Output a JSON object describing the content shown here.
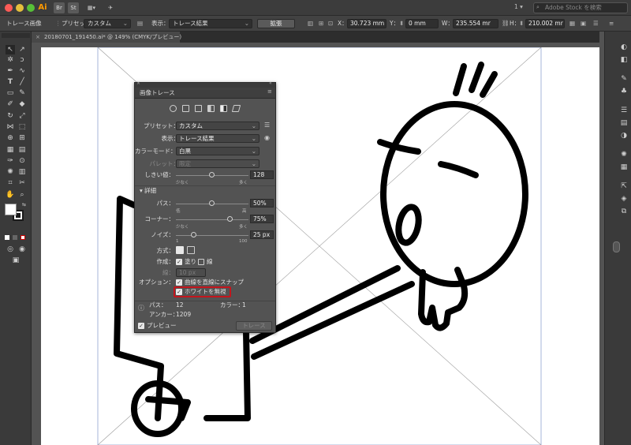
{
  "titlebar": {
    "app_logo": "Ai",
    "bridge_label": "Br",
    "stock_label": "St",
    "workspace_number": "1",
    "stock_search_placeholder": "Adobe Stock を検索"
  },
  "controlbar": {
    "object_label": "トレース画像",
    "preset_label": "プリセット：",
    "preset_value": "カスタム",
    "view_label": "表示：",
    "view_value": "トレース結果",
    "expand_label": "拡張",
    "x_label": "X：",
    "x_value": "30.723 mm",
    "y_label": "Y：",
    "y_value": "0 mm",
    "w_label": "W：",
    "w_value": "235.554 mr",
    "h_label": "H：",
    "h_value": "210.002 mr"
  },
  "document": {
    "tab_title": "20180701_191450.ai* @ 149% (CMYK/プレビュー)"
  },
  "trace_panel": {
    "title": "画像トレース",
    "preset_label": "プリセット：",
    "preset_value": "カスタム",
    "view_label": "表示：",
    "view_value": "トレース結果",
    "mode_label": "カラーモード：",
    "mode_value": "白黒",
    "palette_label": "パレット：",
    "palette_value": "限定",
    "threshold_label": "しきい値：",
    "threshold_value": "128",
    "threshold_fraction": 0.5,
    "threshold_left": "少なく",
    "threshold_right": "多く",
    "advanced_label": "詳細",
    "paths_label": "パス：",
    "paths_value": "50%",
    "paths_fraction": 0.5,
    "paths_left": "低",
    "paths_right": "高",
    "corners_label": "コーナー：",
    "corners_value": "75%",
    "corners_fraction": 0.75,
    "corners_left": "少なく",
    "corners_right": "多く",
    "noise_label": "ノイズ：",
    "noise_value": "25 px",
    "noise_fraction": 0.25,
    "noise_left": "1",
    "noise_right": "100",
    "method_label": "方式：",
    "create_label": "作成：",
    "fill_label": "塗り",
    "fill_checked": true,
    "stroke_label": "線",
    "stroke_checked": false,
    "stroke_width_label": "線：",
    "stroke_width_value": "10 px",
    "options_label": "オプション：",
    "snap_label": "曲線を直線にスナップ",
    "snap_checked": true,
    "ignore_white_label": "ホワイトを無視",
    "ignore_white_checked": true,
    "paths_count_label": "パス：",
    "paths_count_value": "12",
    "colors_label": "カラー：",
    "colors_value": "1",
    "anchors_label": "アンカー：",
    "anchors_value": "1209",
    "preview_label": "プレビュー",
    "preview_checked": true,
    "trace_button_label": "トレース"
  },
  "colors": {
    "highlight": "#c4151c",
    "panel_bg": "#535353",
    "canvas_bg": "#ffffff"
  }
}
